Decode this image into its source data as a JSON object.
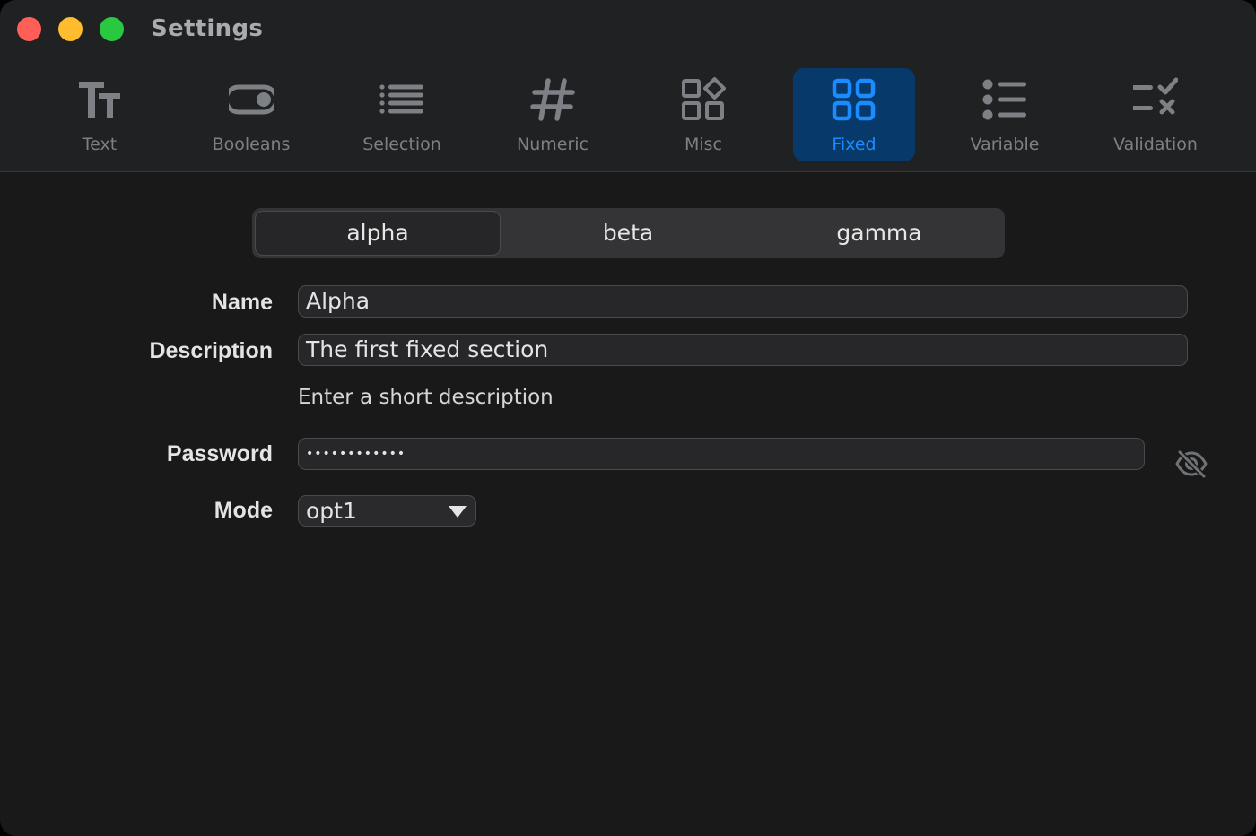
{
  "window": {
    "title": "Settings"
  },
  "toolbar": {
    "items": [
      {
        "label": "Text",
        "icon": "text-size-icon"
      },
      {
        "label": "Booleans",
        "icon": "toggle-icon"
      },
      {
        "label": "Selection",
        "icon": "list-icon"
      },
      {
        "label": "Numeric",
        "icon": "number-sign-icon"
      },
      {
        "label": "Misc",
        "icon": "shapes-icon"
      },
      {
        "label": "Fixed",
        "icon": "grid-icon"
      },
      {
        "label": "Variable",
        "icon": "bullet-list-icon"
      },
      {
        "label": "Validation",
        "icon": "checklist-icon"
      }
    ],
    "selected": "Fixed"
  },
  "segmented": {
    "options": [
      "alpha",
      "beta",
      "gamma"
    ],
    "selected": "alpha"
  },
  "form": {
    "name_label": "Name",
    "name_value": "Alpha",
    "description_label": "Description",
    "description_value": "The first fixed section",
    "description_hint": "Enter a short description",
    "password_label": "Password",
    "password_value": "••••••••••••",
    "mode_label": "Mode",
    "mode_value": "opt1"
  },
  "colors": {
    "accent": "#1a8cff",
    "accent_bg": "#073a6b",
    "background": "#191919",
    "toolbar": "#1f2123"
  }
}
